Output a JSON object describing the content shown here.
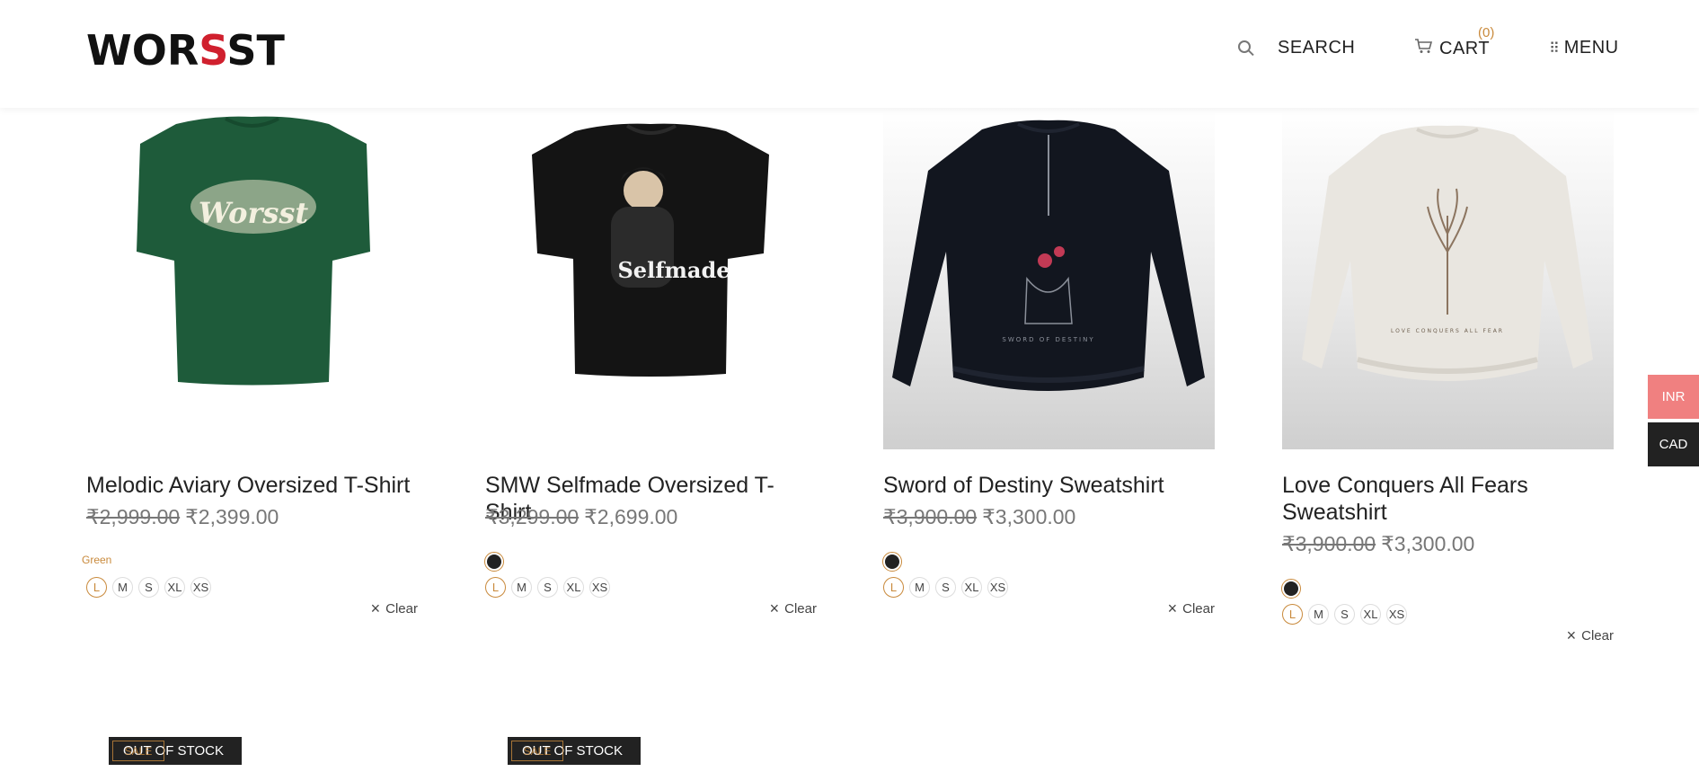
{
  "header": {
    "logo_pre": "WOR",
    "logo_red": "S",
    "logo_post": "ST",
    "search_label": "SEARCH",
    "cart_label": "CART",
    "cart_count": "(0)",
    "menu_label": "MENU"
  },
  "products": [
    {
      "title": "Melodic Aviary Oversized T-Shirt",
      "old_price": "₹2,999.00",
      "price": "₹2,399.00",
      "color_label": "Green",
      "sizes": [
        "L",
        "M",
        "S",
        "XL",
        "XS"
      ],
      "selected_size": "L",
      "clear_label": "Clear"
    },
    {
      "title": "SMW Selfmade Oversized T-Shirt",
      "old_price": "₹3,299.00",
      "price": "₹2,699.00",
      "sizes": [
        "L",
        "M",
        "S",
        "XL",
        "XS"
      ],
      "selected_size": "L",
      "clear_label": "Clear"
    },
    {
      "title": "Sword of Destiny Sweatshirt",
      "old_price": "₹3,900.00",
      "price": "₹3,300.00",
      "sizes": [
        "L",
        "M",
        "S",
        "XL",
        "XS"
      ],
      "selected_size": "L",
      "clear_label": "Clear"
    },
    {
      "title": "Love Conquers All Fears Sweatshirt",
      "old_price": "₹3,900.00",
      "price": "₹3,300.00",
      "sizes": [
        "L",
        "M",
        "S",
        "XL",
        "XS"
      ],
      "selected_size": "L",
      "clear_label": "Clear"
    }
  ],
  "graphics": {
    "tshirt1_text": "Worsst",
    "tshirt2_text": "Selfmade",
    "sweat1_text": "SWORD OF DESTINY",
    "sweat2_text": "LOVE CONQUERS ALL FEAR"
  },
  "currency": {
    "inr": "INR",
    "cad": "CAD"
  },
  "badges": {
    "sale": "SALE",
    "out_of_stock": "OUT OF STOCK"
  },
  "colors": {
    "accent": "#c98a3c",
    "brand_red": "#d0202e",
    "inr_bg": "#f08080",
    "cad_bg": "#222222",
    "tshirt_green": "#1e5b3a"
  }
}
